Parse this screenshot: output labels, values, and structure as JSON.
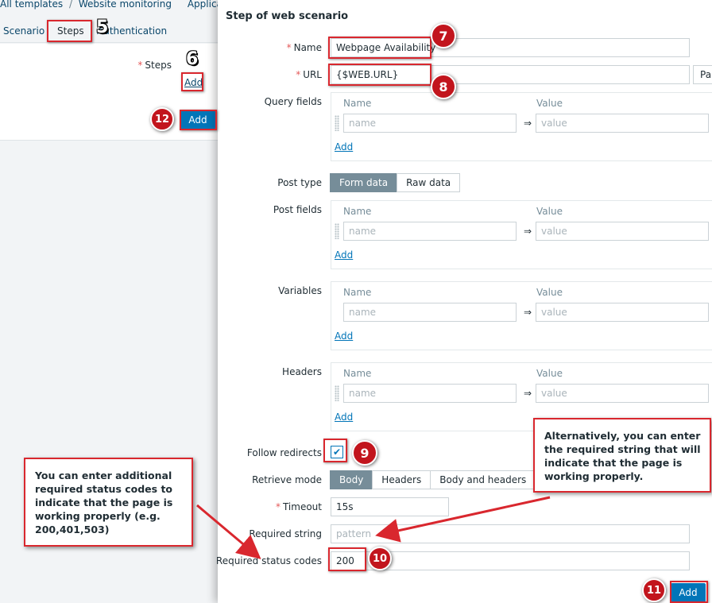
{
  "background_page": {
    "breadcrumb": [
      "All templates",
      "/",
      "Website monitoring",
      "Application"
    ],
    "tabs": [
      "Scenario",
      "Steps",
      "Authentication"
    ],
    "steps_label": "Steps",
    "add_link": "Add",
    "add_button": "Add"
  },
  "modal": {
    "title": "Step of web scenario",
    "name_label": "Name",
    "name_value": "Webpage Availability",
    "url_label": "URL",
    "url_value": "{$WEB.URL}",
    "parse_button": "Pa",
    "query_fields_label": "Query fields",
    "post_type_label": "Post type",
    "post_type_options": [
      "Form data",
      "Raw data"
    ],
    "post_fields_label": "Post fields",
    "variables_label": "Variables",
    "headers_label": "Headers",
    "kv_name_header": "Name",
    "kv_value_header": "Value",
    "kv_name_placeholder": "name",
    "kv_value_placeholder": "value",
    "kv_arrow": "⇒",
    "add_link": "Add",
    "follow_redirects_label": "Follow redirects",
    "follow_redirects_checked": true,
    "retrieve_mode_label": "Retrieve mode",
    "retrieve_mode_options": [
      "Body",
      "Headers",
      "Body and headers"
    ],
    "timeout_label": "Timeout",
    "timeout_value": "15s",
    "required_string_label": "Required string",
    "required_string_placeholder": "pattern",
    "required_status_codes_label": "Required status codes",
    "required_status_codes_value": "200",
    "submit_button": "Add"
  },
  "annotations": {
    "step_numbers": [
      "5",
      "6",
      "7",
      "8",
      "9",
      "10",
      "11",
      "12"
    ],
    "callout_left": "You can enter additional required status codes to indicate that the page is working properly (e.g. 200,401,503)",
    "callout_right": "Alternatively, you can enter the required string that will indicate that the page is working properly.",
    "highlight_color": "#d9272e"
  },
  "colors": {
    "primary_button": "#0275b8",
    "active_segment": "#768d99",
    "link": "#0275b8",
    "required_marker": "#e45959"
  }
}
